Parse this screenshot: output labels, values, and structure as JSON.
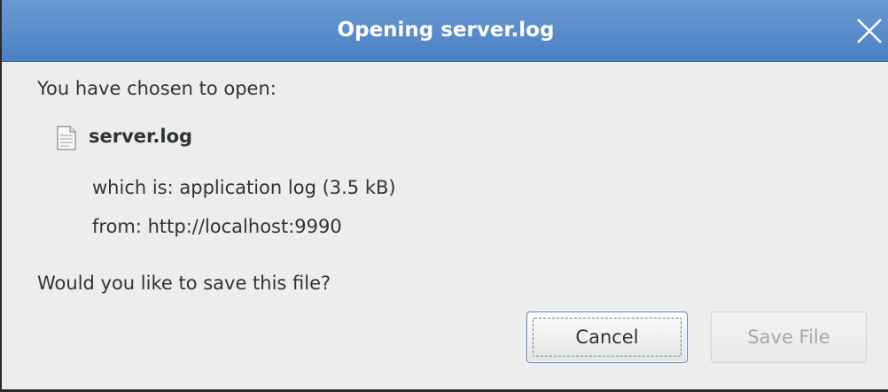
{
  "dialog": {
    "title": "Opening server.log",
    "intro": "You have chosen to open:",
    "file": {
      "name": "server.log",
      "icon": "text-file-icon",
      "which_is": "which is: application log (3.5 kB)",
      "from": "from: http://localhost:9990"
    },
    "question": "Would you like to save this file?",
    "buttons": {
      "cancel": "Cancel",
      "save": "Save File"
    }
  },
  "colors": {
    "titlebar": "#4a80c4",
    "background": "#ededed",
    "text": "#2e3436",
    "disabled_text": "#a8a8a8"
  }
}
